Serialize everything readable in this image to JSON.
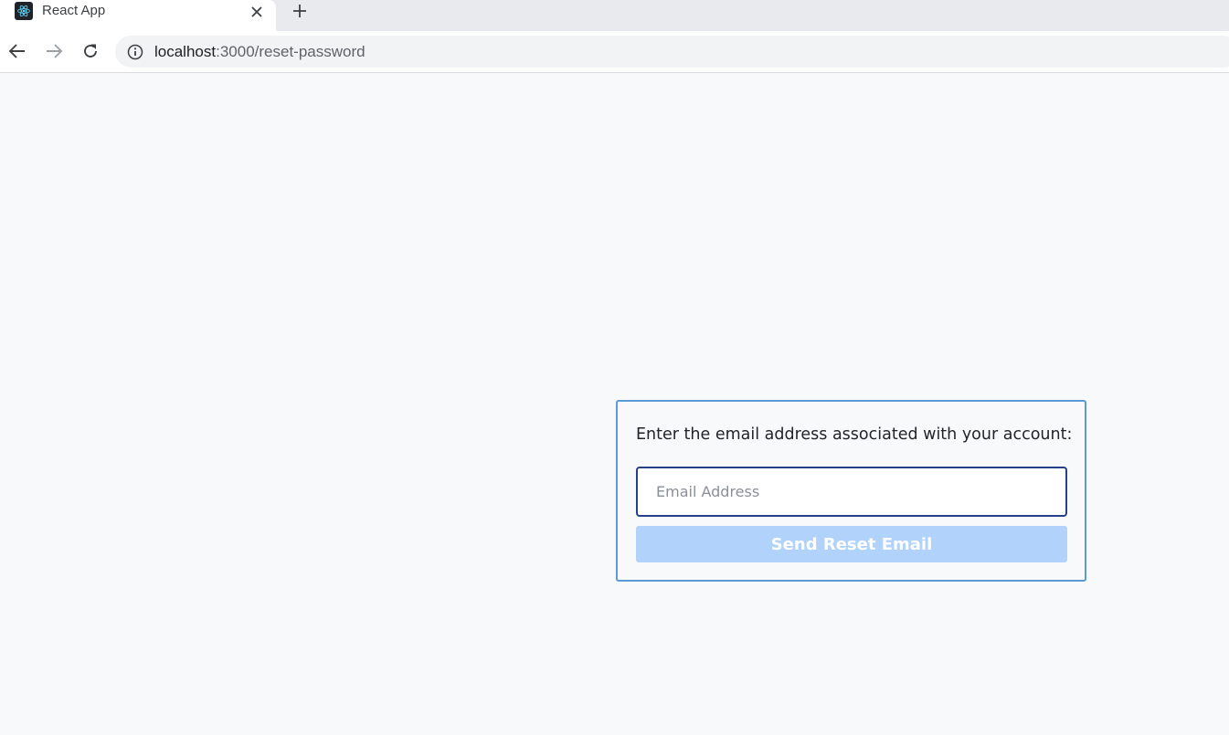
{
  "browser": {
    "tab": {
      "title": "React App",
      "favicon": "react-logo-icon",
      "close_icon": "close-icon"
    },
    "new_tab_icon": "plus-icon",
    "nav": {
      "back_icon": "arrow-left-icon",
      "forward_icon": "arrow-right-icon",
      "reload_icon": "reload-icon"
    },
    "address": {
      "info_icon": "info-icon",
      "host": "localhost",
      "path": ":3000/reset-password"
    }
  },
  "reset_form": {
    "prompt": "Enter the email address associated with your account:",
    "email_placeholder": "Email Address",
    "email_value": "",
    "submit_label": "Send Reset Email",
    "colors": {
      "border": "#5b9bd5",
      "input_border": "#26408b",
      "button_bg": "#b0d2fb"
    }
  }
}
